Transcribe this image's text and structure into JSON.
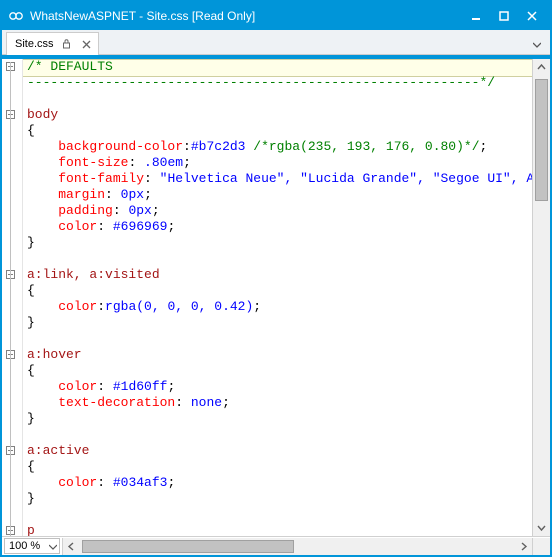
{
  "window": {
    "title": "WhatsNewASPNET - Site.css [Read Only]"
  },
  "tab": {
    "label": "Site.css"
  },
  "zoom": {
    "value": "100 %"
  },
  "code": {
    "lines": [
      {
        "t": "comment-open",
        "text": "/* DEFAULTS"
      },
      {
        "t": "comment-close",
        "text": "----------------------------------------------------------*/"
      },
      {
        "t": "blank",
        "text": ""
      },
      {
        "t": "selector",
        "text": "body"
      },
      {
        "t": "brace",
        "text": "{"
      },
      {
        "t": "decl",
        "indent": 4,
        "prop": "background-color",
        "val": "#b7c2d3",
        "tail_comment": " /*rgba(235, 193, 176, 0.80)*/",
        "tail": ";"
      },
      {
        "t": "decl",
        "indent": 4,
        "prop": "font-size",
        "val": " .80em",
        "tail": ";"
      },
      {
        "t": "decl",
        "indent": 4,
        "prop": "font-family",
        "val": " \"Helvetica Neue\", \"Lucida Grande\", \"Segoe UI\", Aria"
      },
      {
        "t": "decl",
        "indent": 4,
        "prop": "margin",
        "val": " 0px",
        "tail": ";"
      },
      {
        "t": "decl",
        "indent": 4,
        "prop": "padding",
        "val": " 0px",
        "tail": ";"
      },
      {
        "t": "decl",
        "indent": 4,
        "prop": "color",
        "val": " #696969",
        "tail": ";"
      },
      {
        "t": "brace",
        "text": "}"
      },
      {
        "t": "blank",
        "text": ""
      },
      {
        "t": "selector",
        "text": "a:link, a:visited"
      },
      {
        "t": "brace",
        "text": "{"
      },
      {
        "t": "decl",
        "indent": 4,
        "prop": "color",
        "val": "rgba(0, 0, 0, 0.42)",
        "tail": ";"
      },
      {
        "t": "brace",
        "text": "}"
      },
      {
        "t": "blank",
        "text": ""
      },
      {
        "t": "selector",
        "text": "a:hover"
      },
      {
        "t": "brace",
        "text": "{"
      },
      {
        "t": "decl",
        "indent": 4,
        "prop": "color",
        "val": " #1d60ff",
        "tail": ";"
      },
      {
        "t": "decl",
        "indent": 4,
        "prop": "text-decoration",
        "val": " none",
        "tail": ";"
      },
      {
        "t": "brace",
        "text": "}"
      },
      {
        "t": "blank",
        "text": ""
      },
      {
        "t": "selector",
        "text": "a:active"
      },
      {
        "t": "brace",
        "text": "{"
      },
      {
        "t": "decl",
        "indent": 4,
        "prop": "color",
        "val": " #034af3",
        "tail": ";"
      },
      {
        "t": "brace",
        "text": "}"
      },
      {
        "t": "blank",
        "text": ""
      },
      {
        "t": "selector",
        "text": "p"
      }
    ],
    "fold_markers": [
      0,
      3,
      13,
      18,
      24,
      29
    ],
    "current_line": 0
  }
}
